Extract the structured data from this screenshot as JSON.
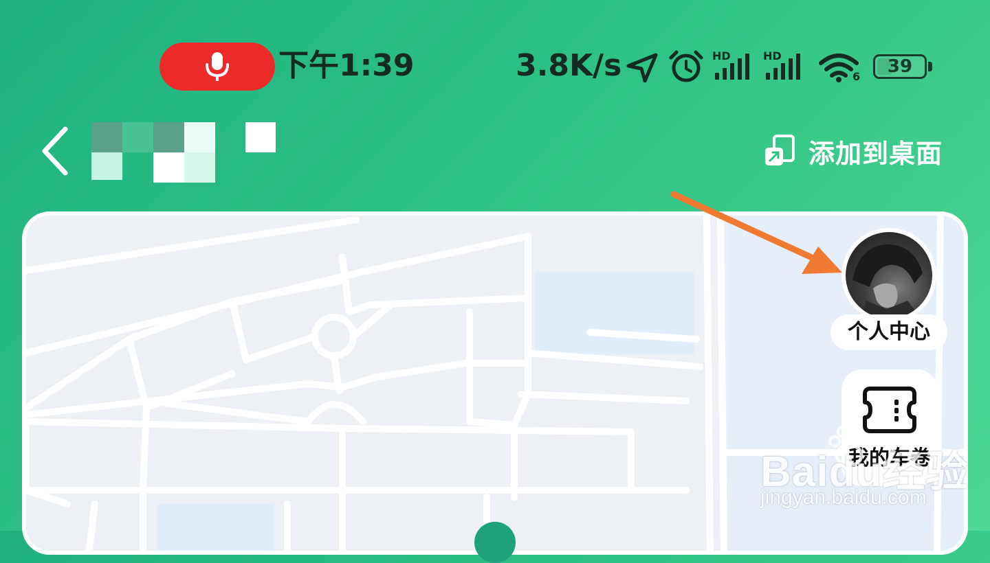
{
  "status_bar": {
    "time": "下午1:39",
    "net_speed": "3.8K/s",
    "battery_level": 39,
    "battery_text": "39",
    "recording_color": "#ec2a2a",
    "icons": [
      "mic-icon",
      "location-arrow-icon",
      "alarm-icon",
      "hd-signal-icon",
      "hd-signal-icon",
      "wifi-icon",
      "battery-icon"
    ],
    "signal_badges": [
      "HD",
      "HD"
    ],
    "wifi_badge": "6"
  },
  "header": {
    "back_icon": "chevron-left-icon",
    "add_to_desktop_label": "添加到桌面",
    "add_to_desktop_icon": "add-to-desktop-icon"
  },
  "map": {
    "profile": {
      "label": "个人中心",
      "avatar": "avatar-image"
    },
    "tickets": {
      "label": "我的车卷",
      "icon": "ticket-icon"
    }
  },
  "watermark": {
    "brand": "Baidu经验",
    "url": "jingyan.baidu.com"
  },
  "colors": {
    "background_start": "#1fb07e",
    "background_end": "#4fd893",
    "annotation_arrow": "#f07a32",
    "map_bg": "#edf1f6"
  }
}
